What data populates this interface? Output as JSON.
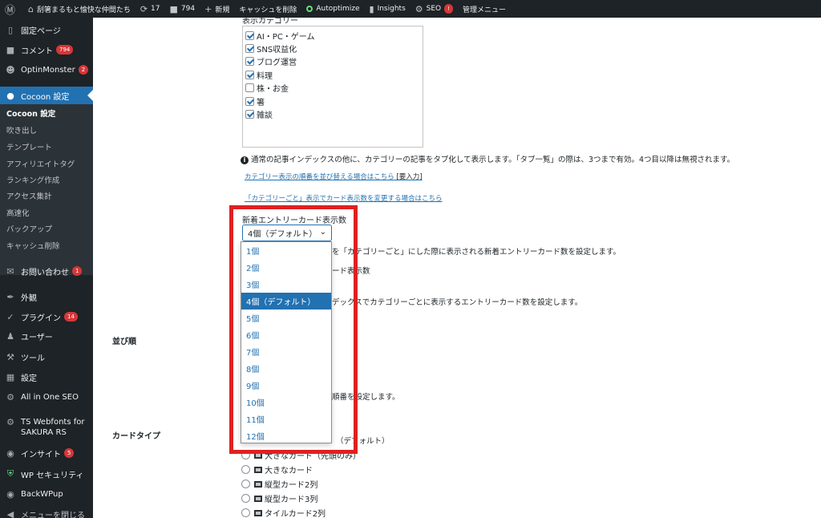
{
  "adminbar": {
    "site_name": "刮箸まるもと愉快な仲間たち",
    "updates_count": "17",
    "comments_count": "794",
    "new_label": "新規",
    "cache_label": "キャッシュを削除",
    "autoptimize_label": "Autoptimize",
    "insights_label": "Insights",
    "seo_label": "SEO",
    "seo_badge": "!",
    "admin_menu_label": "管理メニュー"
  },
  "sidebar": {
    "pages": "固定ページ",
    "comments": "コメント",
    "comments_count": "794",
    "optinmonster": "OptinMonster",
    "optinmonster_count": "2",
    "cocoon": "Cocoon 設定",
    "submenu": [
      "Cocoon 設定",
      "吹き出し",
      "テンプレート",
      "アフィリエイトタグ",
      "ランキング作成",
      "アクセス集計",
      "高速化",
      "バックアップ",
      "キャッシュ削除"
    ],
    "contact": "お問い合わせ",
    "contact_count": "1",
    "appearance": "外観",
    "plugins": "プラグイン",
    "plugins_count": "14",
    "users": "ユーザー",
    "tools": "ツール",
    "settings": "設定",
    "aioseo": "All in One SEO",
    "ts_webfonts_1": "TS Webfonts for",
    "ts_webfonts_2": "SAKURA RS",
    "insight": "インサイト",
    "insight_count": "5",
    "wp_security": "WP セキュリティ",
    "backwpup": "BackWPup",
    "close_menu": "メニューを閉じる"
  },
  "main": {
    "categories_heading": "表示カテゴリー",
    "categories": [
      {
        "label": "AI・PC・ゲーム",
        "checked": true
      },
      {
        "label": "SNS収益化",
        "checked": true
      },
      {
        "label": "ブログ運営",
        "checked": true
      },
      {
        "label": "料理",
        "checked": true
      },
      {
        "label": "株・お金",
        "checked": false
      },
      {
        "label": "箸",
        "checked": true
      },
      {
        "label": "雑談",
        "checked": true
      }
    ],
    "tab_note": "通常の記事インデックスの他に、カテゴリーの記事をタブ化して表示します。「タブ一覧」の際は、3つまで有効。4つ目以降は無視されます。",
    "link_order": "カテゴリー表示の順番を並び替える場合はこちら",
    "link_order_suffix": "[要入力]",
    "link_count": "「カテゴリーごと」表示でカード表示数を変更する場合はこちら",
    "new_entry_label": "新着エントリーカード表示数",
    "select_value": "4個（デフォルト）",
    "options": [
      "1個",
      "2個",
      "3個",
      "4個（デフォルト）",
      "5個",
      "6個",
      "7個",
      "8個",
      "9個",
      "10個",
      "11個",
      "12個"
    ],
    "selected_index": 3,
    "desc_new_entry": "を「カテゴリーごと」にした際に表示される新着エントリーカード数を設定します。",
    "desc_card_count": "ード表示数",
    "desc_per_category": "デックスでカテゴリーごとに表示するエントリーカード数を設定します。",
    "order_label": "並び順",
    "order_desc": "順番を設定します。",
    "card_type_label": "カードタイプ",
    "card_default_suffix": "（デフォルト）",
    "card_types": [
      "大きなカード（先頭のみ）",
      "大きなカード",
      "縦型カード2列",
      "縦型カード3列",
      "タイルカード2列"
    ]
  }
}
